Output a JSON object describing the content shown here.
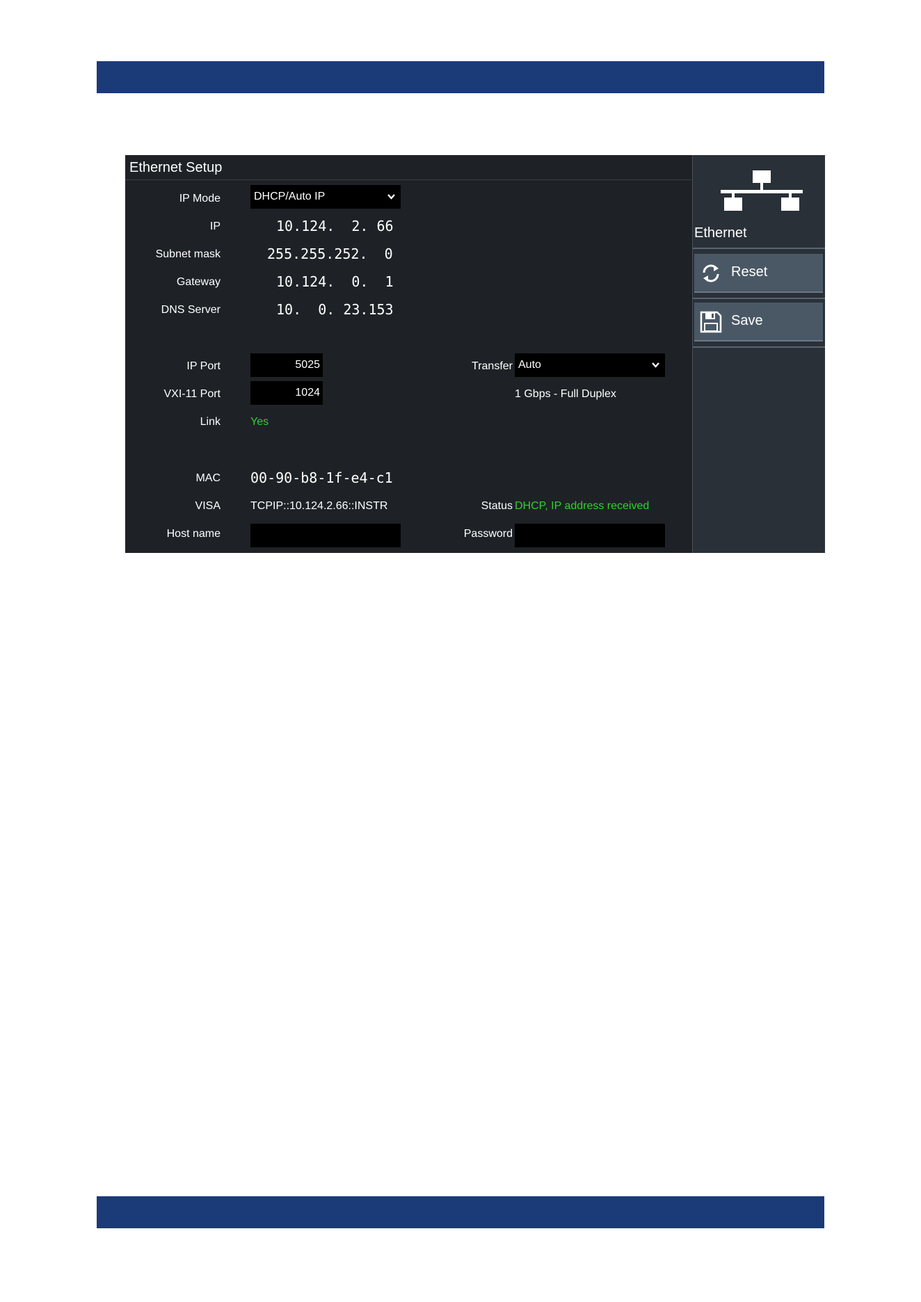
{
  "dialog": {
    "title": "Ethernet Setup",
    "ip_mode": {
      "label": "IP Mode",
      "value": "DHCP/Auto IP"
    },
    "ip": {
      "label": "IP",
      "value": "10.124.  2. 66"
    },
    "subnet": {
      "label": "Subnet mask",
      "value": "255.255.252.  0"
    },
    "gateway": {
      "label": "Gateway",
      "value": "10.124.  0.  1"
    },
    "dns": {
      "label": "DNS Server",
      "value": "10.  0. 23.153"
    },
    "ip_port": {
      "label": "IP Port",
      "value": "5025"
    },
    "vxi_port": {
      "label": "VXI-11 Port",
      "value": "1024"
    },
    "link": {
      "label": "Link",
      "value": "Yes"
    },
    "transfer": {
      "label": "Transfer",
      "value": "Auto",
      "speed": "1 Gbps - Full Duplex"
    },
    "mac": {
      "label": "MAC",
      "value": "00-90-b8-1f-e4-c1"
    },
    "visa": {
      "label": "VISA",
      "value": "TCPIP::10.124.2.66::INSTR"
    },
    "status": {
      "label": "Status",
      "value": "DHCP, IP address received"
    },
    "host_name": {
      "label": "Host name",
      "value": ""
    },
    "password": {
      "label": "Password",
      "value": ""
    }
  },
  "sidebar": {
    "title": "Ethernet",
    "icon": "network-icon",
    "buttons": [
      {
        "label": "Reset",
        "icon": "refresh-icon"
      },
      {
        "label": "Save",
        "icon": "floppy-disk-icon"
      }
    ]
  },
  "colors": {
    "header_band": "#1b3a78",
    "panel_bg": "#1e2226",
    "sidebar_bg": "#2a3038",
    "button_bg": "#4a5866",
    "status_green": "#2ed12e"
  }
}
